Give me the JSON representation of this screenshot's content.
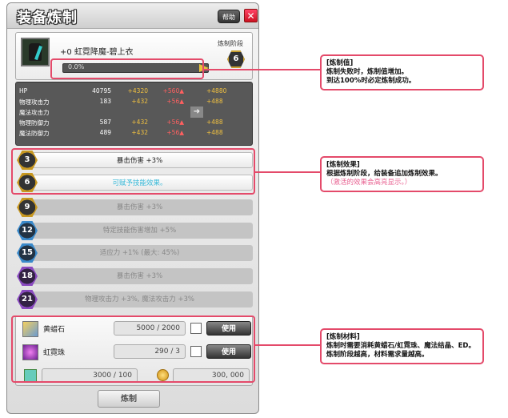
{
  "window": {
    "title": "装备炼制",
    "help_label": "帮助",
    "close_label": "✕"
  },
  "item": {
    "name": "+0  虹霓降魔-碧上衣",
    "refine_stage_label": "炼制阶段",
    "refine_stage": "6",
    "progress_text": "0.0%",
    "progress": 0.0
  },
  "stats": [
    {
      "name": "HP",
      "base": "40795",
      "add": "+4320",
      "plus": "+560▲",
      "result": "+4880"
    },
    {
      "name": "物理攻击力",
      "base": "183",
      "add": "+432",
      "plus": "+56▲",
      "result": "+488"
    },
    {
      "name": "魔法攻击力",
      "base": "",
      "add": "",
      "plus": "",
      "result": ""
    },
    {
      "name": "物理防御力",
      "base": "587",
      "add": "+432",
      "plus": "+56▲",
      "result": "+488"
    },
    {
      "name": "魔法防御力",
      "base": "489",
      "add": "+432",
      "plus": "+56▲",
      "result": "+488"
    }
  ],
  "effects": [
    {
      "stage": "3",
      "text": "暴击伤害 +3%"
    },
    {
      "stage": "6",
      "text": "可赋予技能效果。"
    },
    {
      "stage": "9",
      "text": "暴击伤害 +3%"
    },
    {
      "stage": "12",
      "text": "特定技能伤害增加 +5%"
    },
    {
      "stage": "15",
      "text": "适应力 +1% (最大: 45%)"
    },
    {
      "stage": "18",
      "text": "暴击伤害 +3%"
    },
    {
      "stage": "21",
      "text": "物理攻击力 +3%, 魔法攻击力 +3%"
    }
  ],
  "materials": [
    {
      "name": "黄蜡石",
      "count": "5000 / 2000",
      "use_label": "使用"
    },
    {
      "name": "虹霓珠",
      "count": "290 / 3",
      "use_label": "使用"
    }
  ],
  "cost": {
    "ed": "3000 / 100",
    "gold": "300, 000"
  },
  "refine_button": "炼制",
  "callouts": {
    "value": {
      "title": "[炼制值]",
      "line1": "炼制失败时，炼制值增加。",
      "line2": "到达100%时必定炼制成功。"
    },
    "effect": {
      "title": "[炼制效果]",
      "line1": "根据炼制阶段，给装备追加炼制效果。",
      "hint": "（激活的效果会高亮显示。）"
    },
    "material": {
      "title": "[炼制材料]",
      "line1": "炼制时需要消耗黄蜡石/虹霓珠、魔法结晶、ED。",
      "line2": "炼制阶段越高，材料需求量越高。"
    }
  },
  "colors": {
    "highlight": "#e44a6a",
    "active_effect": "#35b8d8",
    "stat_gold": "#f0c040",
    "stat_red": "#ff6060"
  }
}
